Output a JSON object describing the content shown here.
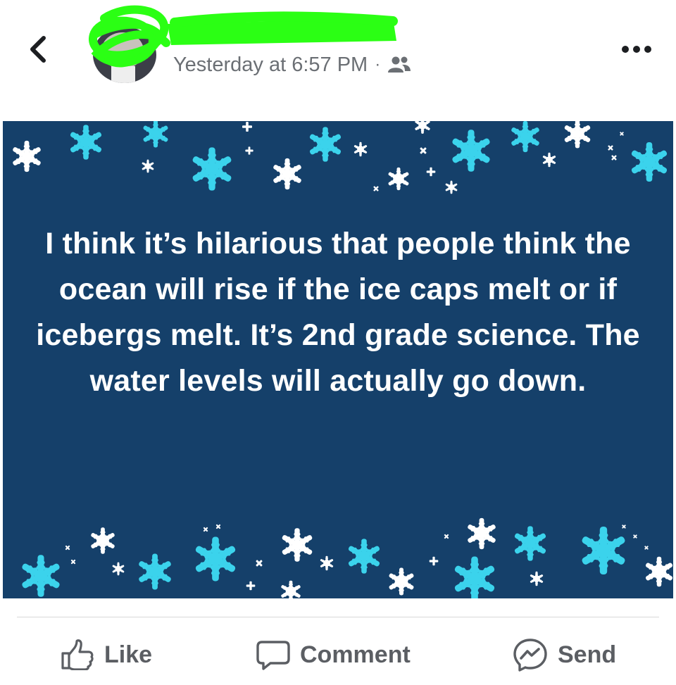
{
  "header": {
    "back_icon": "chevron-left-icon",
    "timestamp": "Yesterday at 6:57 PM",
    "separator": "·",
    "audience_icon": "friends-icon",
    "more_icon": "ellipsis-icon"
  },
  "post": {
    "text": "I think it’s hilarious that people think the ocean will rise if the ice caps melt or if icebergs melt. It’s 2nd grade science. The water levels will actually go down.",
    "background_color": "#15406a",
    "snowflake_color_light": "#3bd3ec",
    "snowflake_color_white": "#ffffff"
  },
  "actions": [
    {
      "label": "Like",
      "icon": "thumbs-up-icon"
    },
    {
      "label": "Comment",
      "icon": "comment-icon"
    },
    {
      "label": "Send",
      "icon": "messenger-icon"
    }
  ]
}
